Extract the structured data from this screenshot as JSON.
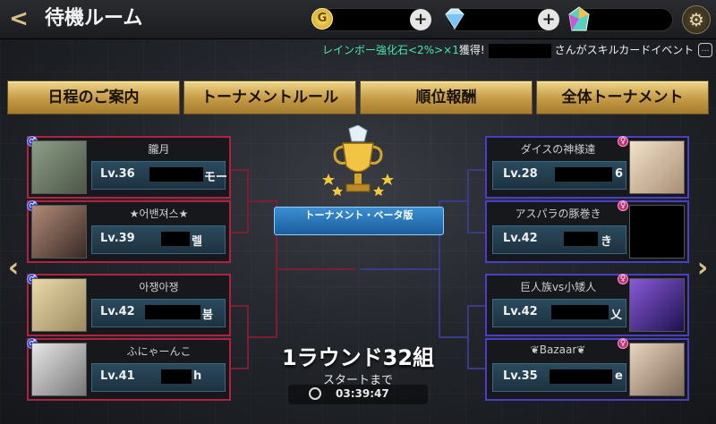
{
  "header": {
    "title": "待機ルーム",
    "ticker": {
      "green_part": "レインボー強化石<2%>×1",
      "white_part": "獲得!",
      "trailing": "さんがスキルカードイベント"
    }
  },
  "tabs": [
    "日程のご案内",
    "トーナメントルール",
    "順位報酬",
    "全体トーナメント"
  ],
  "tournament": {
    "name": "トーナメント・ベータ版",
    "round": "1ラウンド32組",
    "start_label": "スタートまで",
    "countdown": "03:39:47"
  },
  "left_players": [
    {
      "name": "朧月",
      "level": "Lv.36",
      "suffix": "モー"
    },
    {
      "name": "★어밴져스★",
      "level": "Lv.39",
      "suffix": "렐"
    },
    {
      "name": "아쟁아쟁",
      "level": "Lv.42",
      "suffix": "붐"
    },
    {
      "name": "ふにゃーんこ",
      "level": "Lv.41",
      "suffix": "h"
    }
  ],
  "right_players": [
    {
      "name": "ダイスの神様達",
      "level": "Lv.28",
      "suffix": "6"
    },
    {
      "name": "アスパラの豚巻き",
      "level": "Lv.42",
      "suffix": "き"
    },
    {
      "name": "巨人族vs小矮人",
      "level": "Lv.42",
      "suffix": "乂"
    },
    {
      "name": "❦Bazaar❦",
      "level": "Lv.35",
      "suffix": "e"
    }
  ],
  "colors": {
    "accent_gold": "#c49a45",
    "left_border": "#b0223f",
    "right_border": "#4a3fc4"
  },
  "icons": [
    "back-icon",
    "gold-coin-icon",
    "diamond-icon",
    "rainbow-gem-icon",
    "plus-icon",
    "gear-icon",
    "trophy-icon",
    "clock-icon",
    "chat-icon"
  ]
}
